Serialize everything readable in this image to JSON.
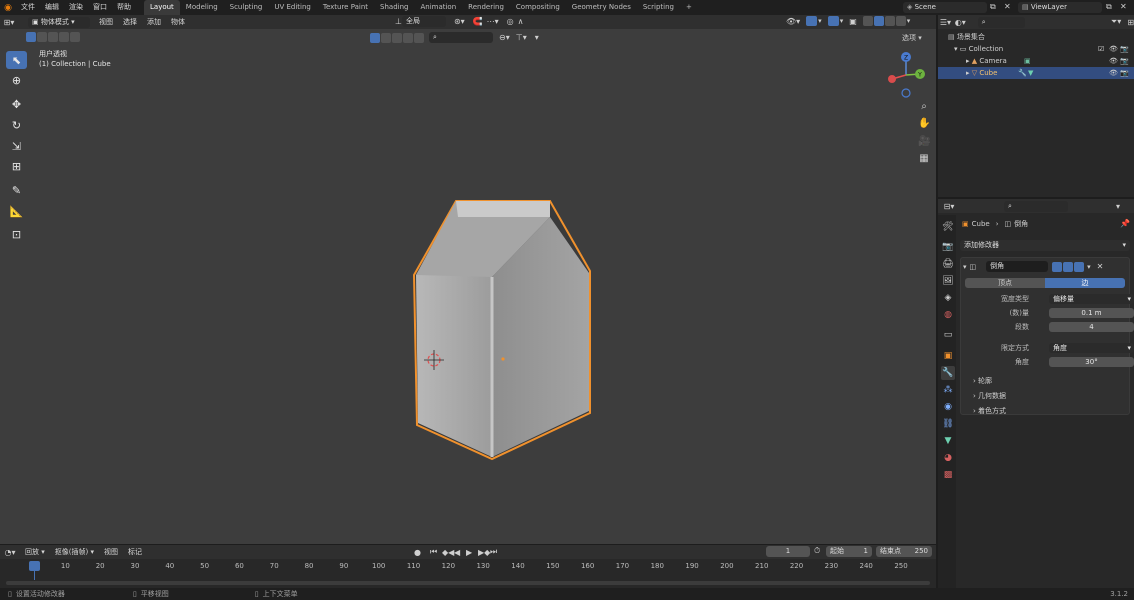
{
  "topbar": {
    "menus": [
      "文件",
      "编辑",
      "渲染",
      "窗口",
      "帮助"
    ],
    "workspaces": [
      "Layout",
      "Modeling",
      "Sculpting",
      "UV Editing",
      "Texture Paint",
      "Shading",
      "Animation",
      "Rendering",
      "Compositing",
      "Geometry Nodes",
      "Scripting"
    ],
    "active_workspace": "Layout",
    "add_tab": "+",
    "scene_name": "Scene",
    "view_layer": "ViewLayer"
  },
  "viewport": {
    "mode": "物体模式",
    "menus": [
      "视图",
      "选择",
      "添加",
      "物体"
    ],
    "transform_orientation": "全局",
    "options_label": "选项",
    "overlay_title": "用户透视",
    "overlay_subtitle": "(1) Collection | Cube",
    "gizmo_z": "Z",
    "gizmo_y": "Y"
  },
  "outliner": {
    "root": "场景集合",
    "items": [
      {
        "label": "Collection"
      },
      {
        "label": "Camera"
      },
      {
        "label": "Cube"
      }
    ]
  },
  "properties": {
    "breadcrumb_object": "Cube",
    "breadcrumb_modifier": "倒角",
    "add_modifier": "添加修改器",
    "modifier_name": "倒角",
    "affect_tabs": [
      "顶点",
      "边"
    ],
    "active_affect": "边",
    "fields": [
      {
        "label": "宽度类型",
        "value": "偏移量",
        "kind": "dropdown"
      },
      {
        "label": "(数)量",
        "value": "0.1 m",
        "kind": "number"
      },
      {
        "label": "段数",
        "value": "4",
        "kind": "number"
      },
      {
        "label": "限定方式",
        "value": "角度",
        "kind": "dropdown"
      },
      {
        "label": "角度",
        "value": "30°",
        "kind": "number"
      }
    ],
    "subpanels": [
      "轮廓",
      "几何数据",
      "着色方式"
    ]
  },
  "timeline": {
    "menus": [
      "回放",
      "抠像(插帧)",
      "视图",
      "标记"
    ],
    "current_frame": "1",
    "start_label": "起始",
    "start_value": "1",
    "end_label": "结束点",
    "end_value": "250",
    "ticks": [
      "1",
      "10",
      "20",
      "30",
      "40",
      "50",
      "60",
      "70",
      "80",
      "90",
      "100",
      "110",
      "120",
      "130",
      "140",
      "150",
      "160",
      "170",
      "180",
      "190",
      "200",
      "210",
      "220",
      "230",
      "240",
      "250"
    ]
  },
  "status": {
    "left": "设置活动修改器",
    "middle": "平移视图",
    "right": "上下文菜单",
    "version": "3.1.2"
  },
  "colors": {
    "accent": "#4772b3",
    "selection_outline": "#f0912d",
    "viewport_bg": "#3d3d3d"
  }
}
